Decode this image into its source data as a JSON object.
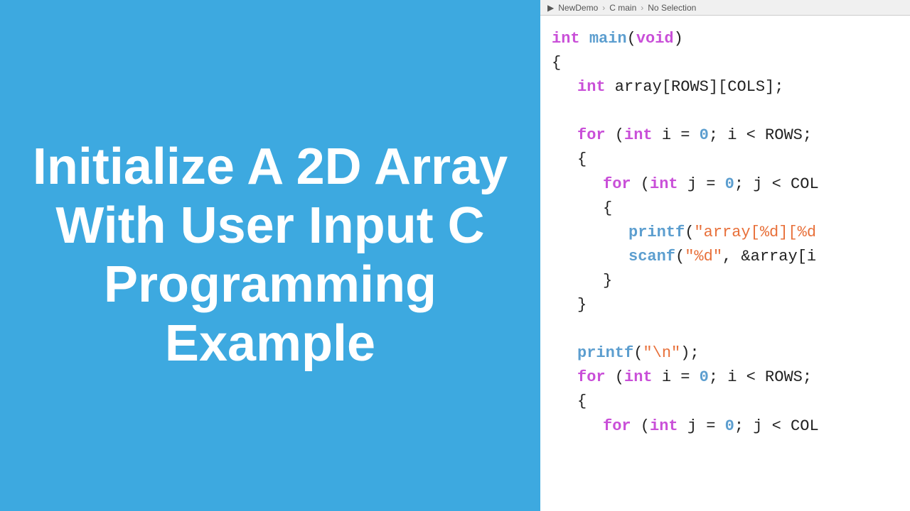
{
  "left": {
    "title": "Initialize A 2D Array With User Input C Programming Example"
  },
  "right": {
    "header": {
      "icon": "▶",
      "project": "NewDemo",
      "separator": "›",
      "file": "C main",
      "separator2": "›",
      "selection": "No Selection"
    },
    "code_lines": [
      {
        "indent": 0,
        "content": "int_main_void"
      },
      {
        "indent": 0,
        "content": "brace_open"
      },
      {
        "indent": 1,
        "content": "int_array_decl"
      },
      {
        "indent": 0,
        "content": "empty"
      },
      {
        "indent": 1,
        "content": "for_rows"
      },
      {
        "indent": 1,
        "content": "brace_open2"
      },
      {
        "indent": 2,
        "content": "for_cols"
      },
      {
        "indent": 2,
        "content": "brace_open3"
      },
      {
        "indent": 3,
        "content": "printf_array"
      },
      {
        "indent": 3,
        "content": "scanf_array"
      },
      {
        "indent": 2,
        "content": "brace_close3"
      },
      {
        "indent": 1,
        "content": "brace_close2"
      },
      {
        "indent": 0,
        "content": "empty2"
      },
      {
        "indent": 1,
        "content": "printf_newline"
      },
      {
        "indent": 1,
        "content": "for_rows2"
      },
      {
        "indent": 1,
        "content": "brace_open4"
      },
      {
        "indent": 2,
        "content": "for_cols2"
      }
    ]
  }
}
